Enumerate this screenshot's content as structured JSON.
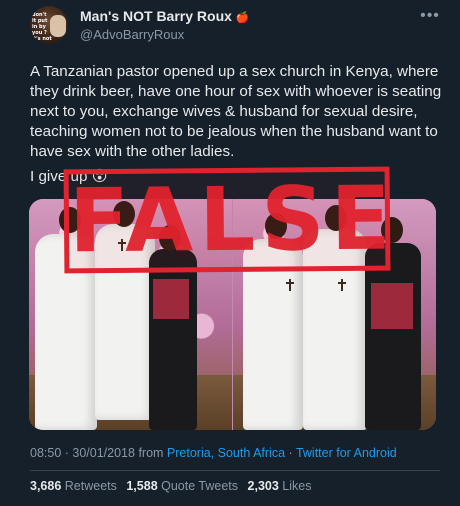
{
  "author": {
    "display_name": "Man's NOT Barry Roux",
    "verified_glyph": "🍎",
    "username": "@AdvoBarryRoux",
    "avatar_text": "don't it put in by you ? it's not"
  },
  "tweet": {
    "paragraph_1": "A Tanzanian pastor opened up a sex church in Kenya, where they drink beer, have one hour of sex with whoever is seating next to you, exchange wives & husband for sexual desire, teaching women not to be jealous when the husband want to have sex with the other ladies.",
    "paragraph_2": "I give up 😲"
  },
  "stamp": {
    "text": "FALSE",
    "color": "#e0232e"
  },
  "meta": {
    "timestamp": "08:50 · 30/01/2018",
    "from_word": "from",
    "location": "Pretoria, South Africa",
    "separator": "·",
    "client": "Twitter for Android"
  },
  "stats": {
    "retweets_count": "3,686",
    "retweets_label": "Retweets",
    "quotes_count": "1,588",
    "quotes_label": "Quote Tweets",
    "likes_count": "2,303",
    "likes_label": "Likes"
  },
  "icons": {
    "more": "more-options-icon"
  },
  "colors": {
    "background": "#15202b",
    "text": "#e7e9ea",
    "secondary": "#8b98a5",
    "link": "#1d9bf0"
  }
}
